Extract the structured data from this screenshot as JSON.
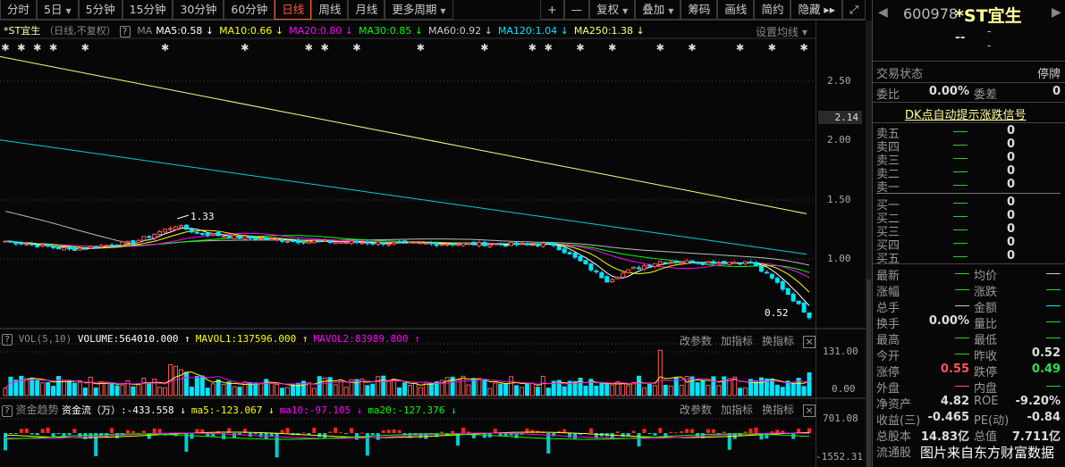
{
  "toolbar": {
    "periods": [
      {
        "label": "分时"
      },
      {
        "label": "5日",
        "caret": true
      },
      {
        "label": "5分钟"
      },
      {
        "label": "15分钟"
      },
      {
        "label": "30分钟"
      },
      {
        "label": "60分钟"
      },
      {
        "label": "日线",
        "active": true
      },
      {
        "label": "周线"
      },
      {
        "label": "月线"
      },
      {
        "label": "更多周期",
        "caret": true
      }
    ],
    "actions": [
      {
        "label": "+"
      },
      {
        "label": "—"
      },
      {
        "label": "复权",
        "caret": true
      },
      {
        "label": "叠加",
        "caret": true
      },
      {
        "label": "筹码"
      },
      {
        "label": "画线"
      },
      {
        "label": "简约"
      },
      {
        "label": "隐藏 ▸▸"
      },
      {
        "label": "⤢"
      }
    ]
  },
  "legend": {
    "name": "*ST宜生",
    "mode": "（日线,不复权）",
    "help": "?",
    "ma_label": "MA",
    "items": [
      {
        "text": "MA5:0.58 ↓",
        "color": "#ffffff"
      },
      {
        "text": "MA10:0.66 ↓",
        "color": "#ffff00"
      },
      {
        "text": "MA20:0.80 ↓",
        "color": "#ff00ff"
      },
      {
        "text": "MA30:0.85 ↓",
        "color": "#00ff00"
      },
      {
        "text": "MA60:0.92 ↓",
        "color": "#cccccc"
      },
      {
        "text": "MA120:1.04 ↓",
        "color": "#00e5ff"
      },
      {
        "text": "MA250:1.38 ↓",
        "color": "#ffff80"
      }
    ],
    "settings": "设置均线 ▾"
  },
  "price_axis": {
    "ticks": [
      "2.50",
      "2.00",
      "1.50",
      "1.00"
    ],
    "current": "2.14"
  },
  "chart_data": {
    "type": "candlestick",
    "price_keypoints": [
      [
        0,
        1.15
      ],
      [
        12,
        1.08
      ],
      [
        24,
        1.14
      ],
      [
        32,
        1.28
      ],
      [
        36,
        1.22
      ],
      [
        44,
        1.18
      ],
      [
        55,
        1.15
      ],
      [
        75,
        1.13
      ],
      [
        103,
        1.12
      ],
      [
        108,
        0.98
      ],
      [
        113,
        0.82
      ],
      [
        118,
        0.92
      ],
      [
        123,
        0.98
      ],
      [
        140,
        0.97
      ],
      [
        145,
        0.8
      ],
      [
        151,
        0.52
      ]
    ],
    "ma250": [
      2.7,
      1.38
    ],
    "ma120": [
      2.0,
      1.04
    ],
    "ma60_start": 1.4,
    "annotations": {
      "high": "1.33",
      "low": "0.52"
    },
    "volume_ticks": [
      "131.00",
      "0.00"
    ],
    "flow_ticks": [
      "701.08",
      "-1552.31"
    ]
  },
  "volume": {
    "help": "?",
    "title": "VOL(5,10)",
    "items": [
      {
        "text": "VOLUME:564010.000 ↑",
        "color": "#ffffff"
      },
      {
        "text": "MAVOL1:137596.000 ↑",
        "color": "#ffff00"
      },
      {
        "text": "MAVOL2:83989.800 ↑",
        "color": "#ff00ff"
      }
    ]
  },
  "flow": {
    "help": "?",
    "title": "资金趋势",
    "items": [
      {
        "text": "资金流（万）:-433.558 ↓",
        "color": "#ffffff"
      },
      {
        "text": "ma5:-123.067 ↓",
        "color": "#ffff00"
      },
      {
        "text": "ma10:-97.105 ↓",
        "color": "#ff00ff"
      },
      {
        "text": "ma20:-127.376 ↓",
        "color": "#00ff00"
      }
    ]
  },
  "subtools": [
    "改参数",
    "加指标",
    "换指标"
  ],
  "close": "×",
  "quote": {
    "code": "600978",
    "name": "*ST宜生",
    "price": "--",
    "chg1": "-",
    "chg2": "-",
    "status_label": "交易状态",
    "status": "停牌",
    "wb_label": "委比",
    "wb": "0.00%",
    "wc_label": "委差",
    "wc": "0",
    "dk": "DK点自动提示涨跌信号",
    "sells": [
      {
        "label": "卖五",
        "vol": "0"
      },
      {
        "label": "卖四",
        "vol": "0"
      },
      {
        "label": "卖三",
        "vol": "0"
      },
      {
        "label": "卖二",
        "vol": "0"
      },
      {
        "label": "卖一",
        "vol": "0"
      }
    ],
    "buys": [
      {
        "label": "买一",
        "vol": "0"
      },
      {
        "label": "买二",
        "vol": "0"
      },
      {
        "label": "买三",
        "vol": "0"
      },
      {
        "label": "买四",
        "vol": "0"
      },
      {
        "label": "买五",
        "vol": "0"
      }
    ],
    "stats": [
      [
        {
          "l": "最新",
          "v": "—",
          "c": "#3c3"
        },
        {
          "l": "均价",
          "v": "—",
          "c": "#ccc"
        }
      ],
      [
        {
          "l": "涨幅",
          "v": "—",
          "c": "#3c3"
        },
        {
          "l": "涨跌",
          "v": "—",
          "c": "#3c3"
        }
      ],
      [
        {
          "l": "总手",
          "v": "—",
          "c": "#ccc"
        },
        {
          "l": "金额",
          "v": "—",
          "c": "#0ee"
        }
      ],
      [
        {
          "l": "换手",
          "v": "0.00%",
          "c": "#ddd"
        },
        {
          "l": "量比",
          "v": "—",
          "c": "#3c3"
        }
      ],
      [
        {
          "l": "最高",
          "v": "—",
          "c": "#3c3"
        },
        {
          "l": "最低",
          "v": "—",
          "c": "#3c3"
        }
      ],
      [
        {
          "l": "今开",
          "v": "—",
          "c": "#3c3"
        },
        {
          "l": "昨收",
          "v": "0.52",
          "c": "#ddd"
        }
      ],
      [
        {
          "l": "涨停",
          "v": "0.55",
          "c": "#ff5555"
        },
        {
          "l": "跌停",
          "v": "0.49",
          "c": "#33dd55"
        }
      ],
      [
        {
          "l": "外盘",
          "v": "—",
          "c": "#ff5555"
        },
        {
          "l": "内盘",
          "v": "—",
          "c": "#3c3"
        }
      ],
      [
        {
          "l": "净资产",
          "v": "4.82",
          "c": "#ddd"
        },
        {
          "l": "ROE",
          "v": "-9.20%",
          "c": "#ddd"
        }
      ],
      [
        {
          "l": "收益(三)",
          "v": "-0.465",
          "c": "#ddd"
        },
        {
          "l": "PE(动)",
          "v": "-0.84",
          "c": "#ddd"
        }
      ],
      [
        {
          "l": "总股本",
          "v": "14.83亿",
          "c": "#ddd"
        },
        {
          "l": "总值",
          "v": "7.711亿",
          "c": "#ddd"
        }
      ],
      [
        {
          "l": "流通股",
          "v": "",
          "c": "#ddd"
        },
        {
          "l": "",
          "v": "",
          "c": "#ddd"
        }
      ]
    ],
    "watermark": "图片来自东方财富数据"
  }
}
